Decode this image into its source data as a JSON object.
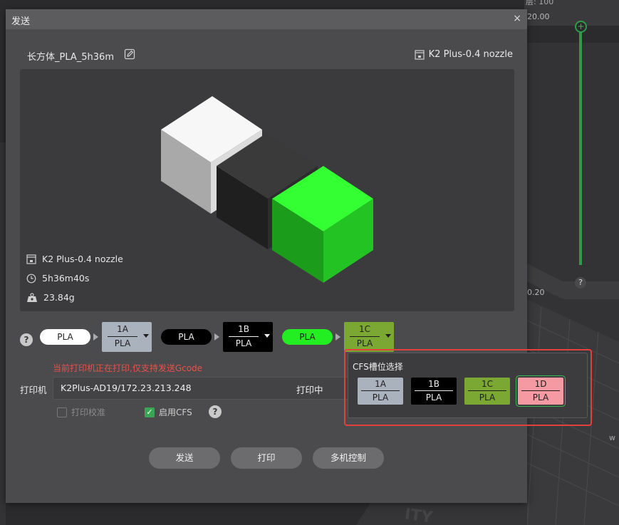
{
  "background": {
    "layer_label": "层: 100",
    "layer_top": "20.00",
    "layer_bottom": "0.20",
    "help": "?",
    "bed_text_right": "w",
    "bed_text_bottom": "ITY"
  },
  "dialog": {
    "title": "发送",
    "close": "×",
    "file_name": "长方体_PLA_5h36m",
    "printer_model_top": "K2 Plus-0.4 nozzle"
  },
  "preview": {
    "printer_model": "K2 Plus-0.4 nozzle",
    "print_time": "5h36m40s",
    "weight": "23.84g"
  },
  "mapping": {
    "help": "?",
    "items": [
      {
        "material": "PLA",
        "pill_color": "#ffffff",
        "pill_text_color": "#222222",
        "slot_id": "1A",
        "slot_type": "PLA",
        "slot_color": "#a9b2bd",
        "slot_text_color": "#1e1e1e"
      },
      {
        "material": "PLA",
        "pill_color": "#000000",
        "pill_text_color": "#f0f0f0",
        "slot_id": "1B",
        "slot_type": "PLA",
        "slot_color": "#000000",
        "slot_text_color": "#f0f0f0"
      },
      {
        "material": "PLA",
        "pill_color": "#22ee22",
        "pill_text_color": "#1a1a1a",
        "slot_id": "1C",
        "slot_type": "PLA",
        "slot_color": "#7aa832",
        "slot_text_color": "#1e1e1e"
      }
    ]
  },
  "warning": "当前打印机正在打印,仅支持发送Gcode",
  "printer": {
    "label": "打印机",
    "name": "K2Plus-AD19/172.23.213.248",
    "status": "打印中"
  },
  "options": {
    "calibrate_label": "打印校准",
    "calibrate_checked": false,
    "cfs_label": "启用CFS",
    "cfs_checked": true,
    "check_mark": "✓",
    "help": "?"
  },
  "buttons": {
    "send": "发送",
    "print": "打印",
    "multi_control": "多机控制"
  },
  "cfs_popup": {
    "title": "CFS槽位选择",
    "selected": "1D",
    "slots": [
      {
        "id": "1A",
        "type": "PLA",
        "color": "#a9b2bd",
        "text_color": "#1e1e1e"
      },
      {
        "id": "1B",
        "type": "PLA",
        "color": "#000000",
        "text_color": "#f0f0f0"
      },
      {
        "id": "1C",
        "type": "PLA",
        "color": "#7aa832",
        "text_color": "#1e1e1e"
      },
      {
        "id": "1D",
        "type": "PLA",
        "color": "#f59aa2",
        "text_color": "#1e1e1e"
      }
    ]
  }
}
